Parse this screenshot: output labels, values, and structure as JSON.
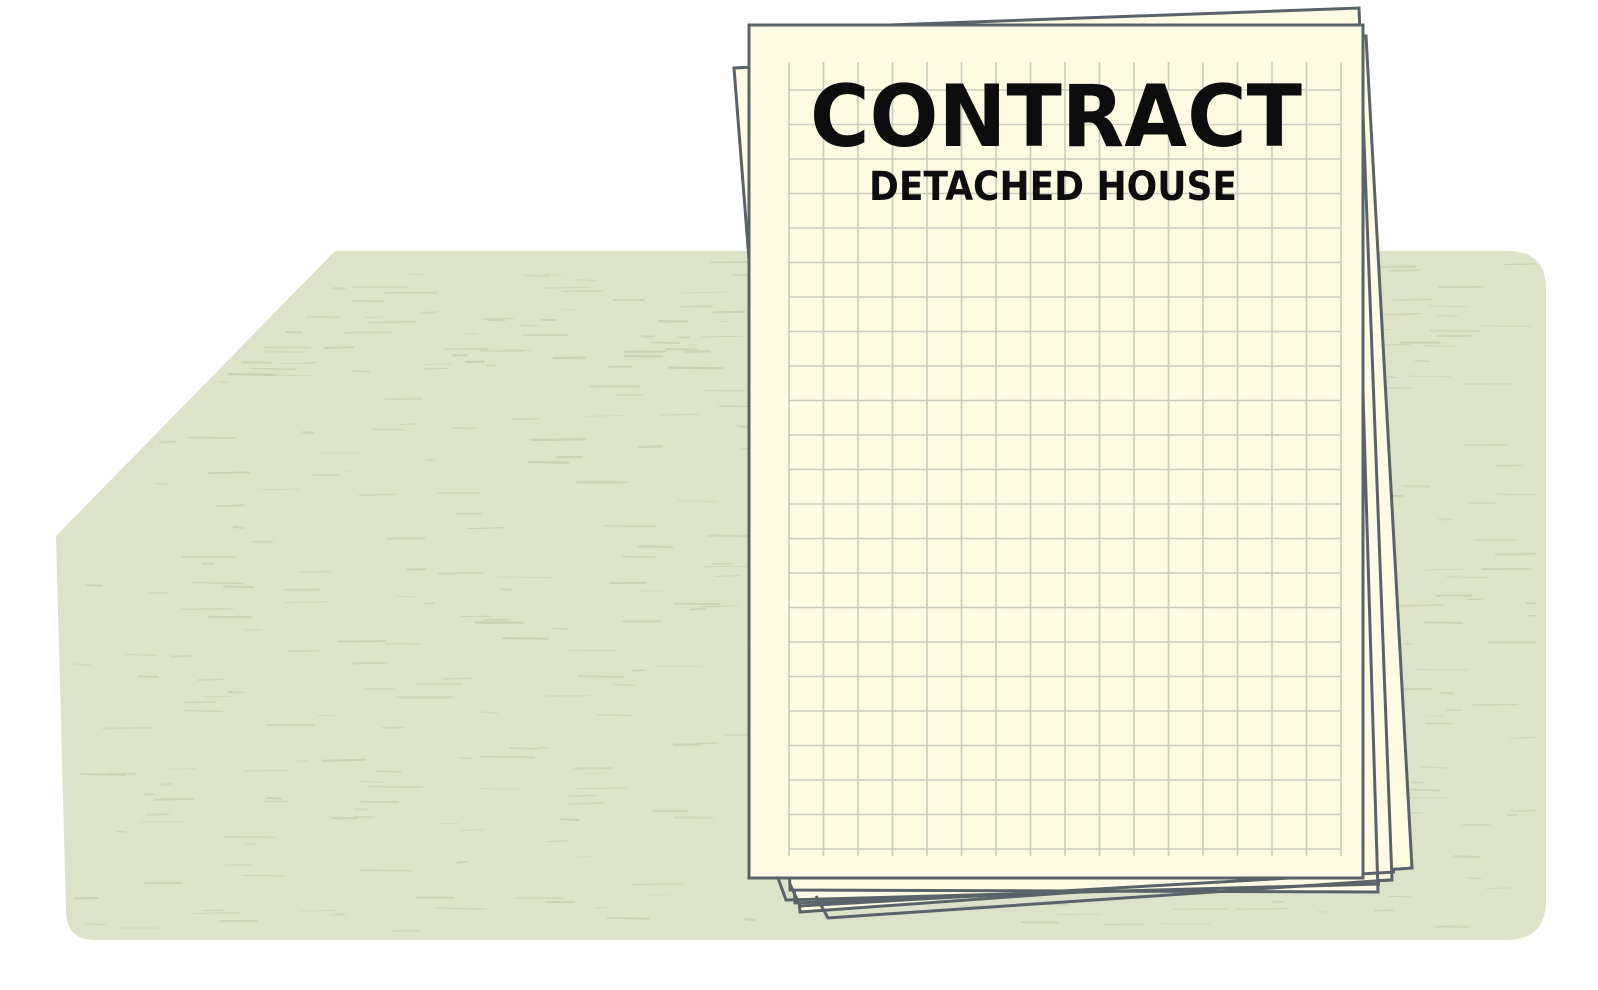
{
  "document": {
    "title": "CONTRACT",
    "subtitle": "DETACHED HOUSE"
  },
  "colors": {
    "background": "#ffffff",
    "desk": "#dce3c9",
    "desk_grain": "#c7d0b0",
    "paper": "#fdfbe2",
    "paper_border": "#5a6369",
    "grid_line": "#c9ccbf",
    "title": "#0d0d0d"
  },
  "icons": [
    "paper-stack-icon"
  ]
}
